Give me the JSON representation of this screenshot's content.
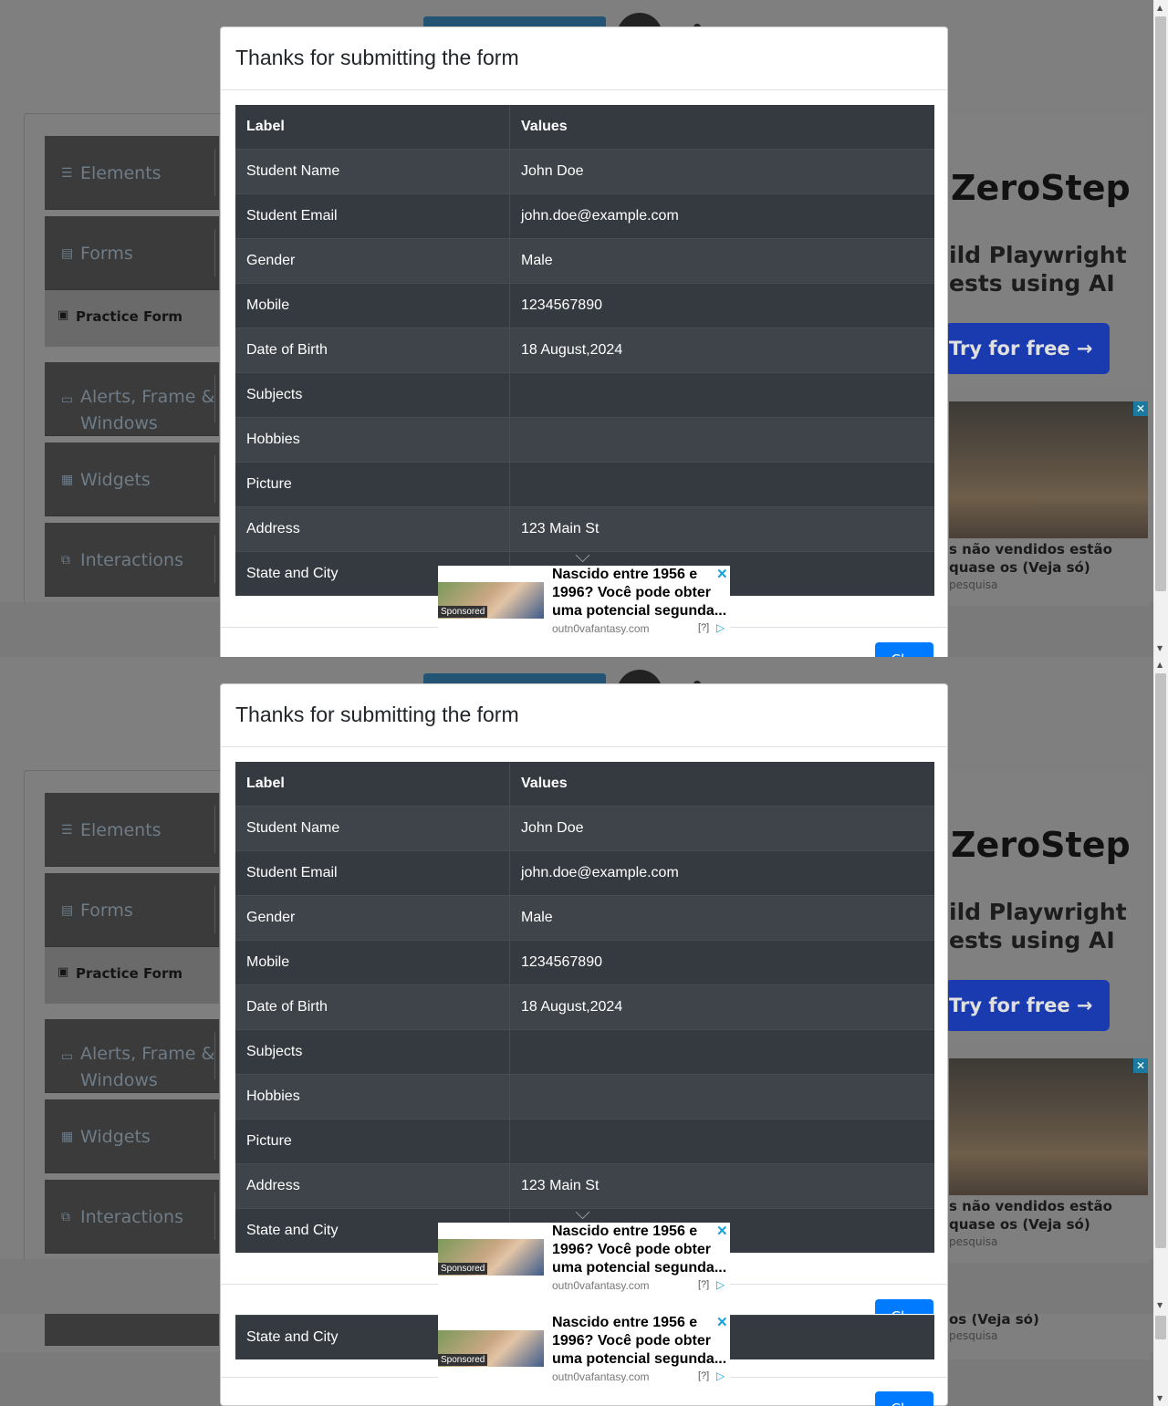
{
  "modal": {
    "title": "Thanks for submitting the form",
    "columns": [
      "Label",
      "Values"
    ],
    "rows": [
      {
        "label": "Student Name",
        "value": "John Doe"
      },
      {
        "label": "Student Email",
        "value": "john.doe@example.com"
      },
      {
        "label": "Gender",
        "value": "Male"
      },
      {
        "label": "Mobile",
        "value": "1234567890"
      },
      {
        "label": "Date of Birth",
        "value": "18 August,2024"
      },
      {
        "label": "Subjects",
        "value": ""
      },
      {
        "label": "Hobbies",
        "value": ""
      },
      {
        "label": "Picture",
        "value": ""
      },
      {
        "label": "Address",
        "value": "123 Main St"
      },
      {
        "label": "State and City",
        "value": ""
      }
    ],
    "close_label": "Cl..."
  },
  "sidebar": {
    "elements_label": "Elements",
    "forms_label": "Forms",
    "practice_form_label": "Practice Form",
    "alerts_label": "Alerts, Frame & Windows",
    "widgets_label": "Widgets",
    "interactions_label": "Interactions"
  },
  "right_ad": {
    "brand": "ZeroStep",
    "subtitle": "ild Playwright ests using AI",
    "cta": "Try for free →",
    "caption": "s não vendidos estão quase os (Veja só)",
    "caption_partial": "os (Veja só)",
    "source": "pesquisa"
  },
  "sponsored": {
    "line1": "Nascido entre 1956 e",
    "line2": "1996? Você pode obter",
    "line3": "uma potencial segunda...",
    "tag": "Sponsored",
    "url": "outn0vafantasy.com",
    "help": "[?]"
  },
  "icons": {
    "elements": "hamburger-icon",
    "forms": "document-icon",
    "practice": "form-icon",
    "alerts": "window-icon",
    "widgets": "widgets-icon",
    "interactions": "interactions-icon"
  },
  "colors": {
    "table_dark": "#343a40",
    "table_alt": "#3e444a",
    "primary": "#007bff",
    "overlay": "#7f7f7f"
  }
}
